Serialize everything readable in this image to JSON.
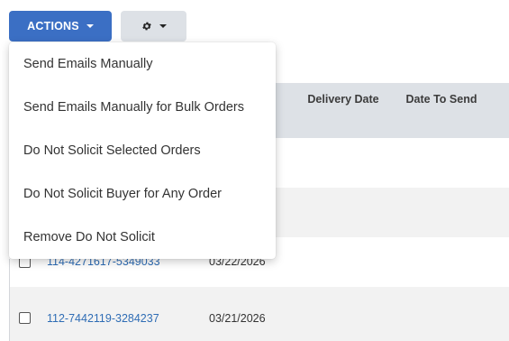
{
  "toolbar": {
    "actions_label": "ACTIONS",
    "actions_icon": "chevron-down-icon",
    "settings_icon": "gear-icon",
    "settings_caret_icon": "chevron-down-icon"
  },
  "table": {
    "columns": [
      {
        "label": "Delivery Date"
      },
      {
        "label": "Date To Send"
      }
    ],
    "rows": [
      {
        "order_id": "114-4271617-5349033",
        "date": "03/22/2026"
      },
      {
        "order_id": "112-7442119-3284237",
        "date": "03/21/2026"
      }
    ]
  },
  "dropdown": {
    "items": [
      {
        "label": "Send Emails Manually"
      },
      {
        "label": "Send Emails Manually for Bulk Orders"
      },
      {
        "label": "Do Not Solicit Selected Orders"
      },
      {
        "label": "Do Not Solicit Buyer for Any Order"
      },
      {
        "label": "Remove Do Not Solicit"
      }
    ]
  },
  "colors": {
    "accent": "#3b6fc4",
    "link": "#2f6db5",
    "header_bg": "#dde1e6"
  }
}
